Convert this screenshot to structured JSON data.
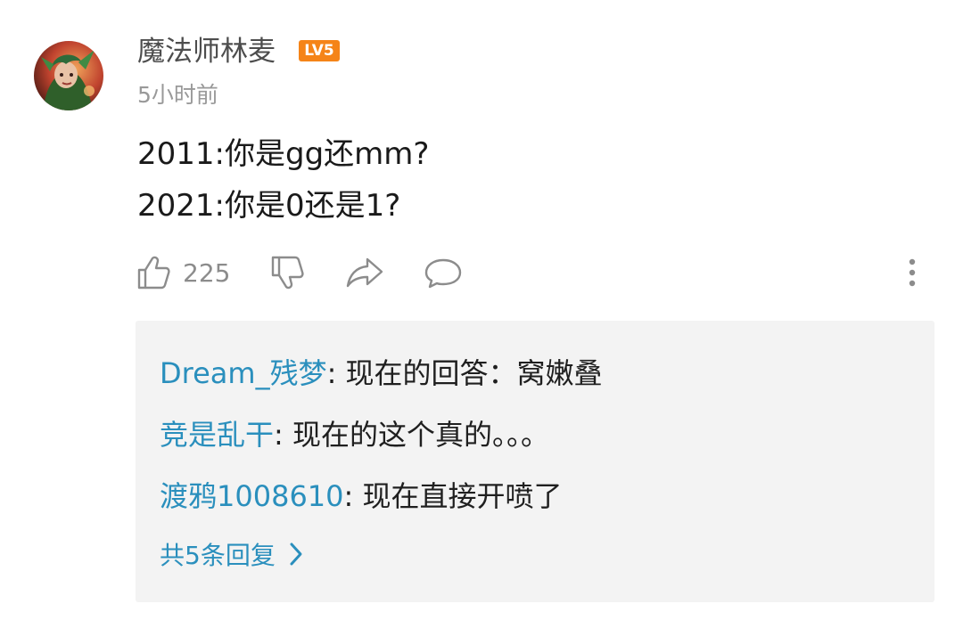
{
  "comment": {
    "username": "魔法师林麦",
    "level_badge": "LV5",
    "time": "5小时前",
    "content_lines": [
      "2011:你是gg还mm?",
      "2021:你是0还是1?"
    ],
    "like_count": "225",
    "icons": {
      "avatar": "avatar-image",
      "like": "thumbs-up-icon",
      "dislike": "thumbs-down-icon",
      "share": "share-icon",
      "comment": "comment-bubble-icon",
      "more": "more-vertical-icon"
    }
  },
  "replies": [
    {
      "author": "Dream_残梦",
      "separator": ": ",
      "text": "现在的回答：窝嫩叠"
    },
    {
      "author": "竞是乱干",
      "separator": ": ",
      "text": "现在的这个真的。。。"
    },
    {
      "author": "渡鸦1008610",
      "separator": ": ",
      "text": "现在直接开喷了"
    }
  ],
  "more_replies_label": "共5条回复",
  "colors": {
    "link_blue": "#2a8fbd",
    "badge_orange": "#f58418",
    "muted_gray": "#999999",
    "reply_background": "#f3f3f3"
  }
}
